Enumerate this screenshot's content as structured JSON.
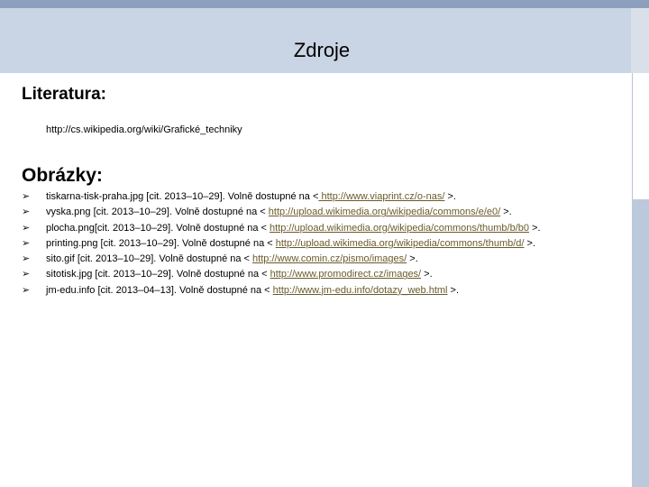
{
  "slide": {
    "title": "Zdroje",
    "literature": {
      "heading": "Literatura:",
      "entry": "http://cs.wikipedia.org/wiki/Grafické_techniky"
    },
    "images": {
      "heading": "Obrázky:",
      "bullet_glyph": "➢",
      "items": [
        {
          "text": "tiskarna-tisk-praha.jpg [cit. 2013–10–29]. Volně dostupné na <",
          "link": " http://www.viaprint.cz/o-nas/",
          "suffix": " >."
        },
        {
          "text": "vyska.png [cit. 2013–10–29]. Volně dostupné na < ",
          "link": "http://upload.wikimedia.org/wikipedia/commons/e/e0/",
          "suffix": " >."
        },
        {
          "text": "plocha.png[cit. 2013–10–29]. Volně dostupné na < ",
          "link": "http://upload.wikimedia.org/wikipedia/commons/thumb/b/b0",
          "suffix": " >."
        },
        {
          "text": "printing.png [cit. 2013–10–29]. Volně dostupné na < ",
          "link": "http://upload.wikimedia.org/wikipedia/commons/thumb/d/",
          "suffix": " >."
        },
        {
          "text": "sito.gif [cit. 2013–10–29]. Volně dostupné na < ",
          "link": "http://www.comin.cz/pismo/images/",
          "suffix": " >."
        },
        {
          "text": "sitotisk.jpg [cit. 2013–10–29]. Volně dostupné na < ",
          "link": "http://www.promodirect.cz/images/",
          "suffix": "  >."
        },
        {
          "text": "jm-edu.info [cit. 2013–04–13]. Volně dostupné na < ",
          "link": "http://www.jm-edu.info/dotazy_web.html",
          "suffix": " >."
        }
      ]
    }
  },
  "colors": {
    "header_band": "#c9d4e4",
    "top_bar": "#8c9fbd",
    "link": "#6a5a2a"
  }
}
